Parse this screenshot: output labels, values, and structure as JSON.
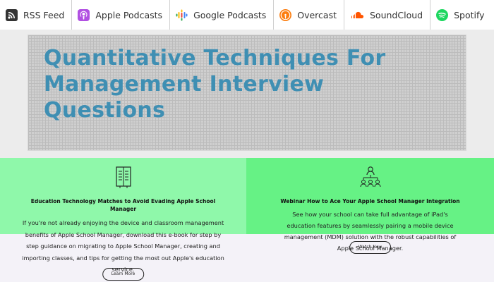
{
  "podcast_bar": {
    "items": [
      {
        "label": "RSS Feed",
        "icon": "rss-icon",
        "color": "#333333"
      },
      {
        "label": "Apple Podcasts",
        "icon": "apple-podcasts-icon",
        "color": "#b150e2"
      },
      {
        "label": "Google Podcasts",
        "icon": "google-podcasts-icon",
        "color": "#4285f4"
      },
      {
        "label": "Overcast",
        "icon": "overcast-icon",
        "color": "#fc7e0f"
      },
      {
        "label": "SoundCloud",
        "icon": "soundcloud-icon",
        "color": "#ff5500"
      },
      {
        "label": "Spotify",
        "icon": "spotify-icon",
        "color": "#1ed760"
      }
    ]
  },
  "hero": {
    "title": "Quantitative Techniques For Management Interview Questions",
    "title_color": "#3f8fb3"
  },
  "cards": [
    {
      "icon": "file-columns-icon",
      "title": "Education Technology Matches to Avoid Evading Apple School Manager",
      "text": "If you're not already enjoying the device and classroom management benefits of Apple School Manager, download this e-book for step by step guidance on migrating to Apple School Manager, creating and importing classes, and tips for getting the most out Apple's education service.",
      "button": "Learn More",
      "background": "#8ff8aa"
    },
    {
      "icon": "network-users-icon",
      "title": "Webinar How to Ace Your Apple School Manager Integration",
      "text": "See how your school can take full advantage of iPad's education features by seamlessly pairing a mobile device management (MDM) solution with the robust capabilities of Apple School Manager.",
      "button": "Watch Now",
      "background": "#66f285"
    }
  ]
}
